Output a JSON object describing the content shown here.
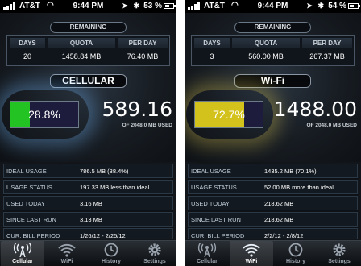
{
  "screens": [
    {
      "id": "cellular",
      "status": {
        "carrier": "AT&T",
        "time": "9:44 PM",
        "battery": "53 %"
      },
      "remaining": {
        "title": "REMAINING",
        "days_label": "DAYS",
        "days": "20",
        "quota_label": "QUOTA",
        "quota": "1458.84 MB",
        "perday_label": "PER DAY",
        "perday": "76.40 MB"
      },
      "mode": "CELLULAR",
      "gauge": {
        "percent_text": "28.8%",
        "fraction": 0.288,
        "color": "#22c322"
      },
      "used": {
        "value": "589.16",
        "caption": "OF 2048.0 MB USED"
      },
      "stats": [
        {
          "label": "IDEAL USAGE",
          "value": "786.5 MB (38.4%)"
        },
        {
          "label": "USAGE STATUS",
          "value": "197.33 MB less than ideal"
        },
        {
          "label": "USED TODAY",
          "value": "3.16 MB"
        },
        {
          "label": "SINCE LAST RUN",
          "value": "3.13 MB"
        },
        {
          "label": "CUR. BILL PERIOD",
          "value": "1/26/12 - 2/25/12"
        }
      ],
      "tabs": [
        "Cellular",
        "WiFi",
        "History",
        "Settings"
      ],
      "active_tab": 0
    },
    {
      "id": "wifi",
      "status": {
        "carrier": "AT&T",
        "time": "9:44 PM",
        "battery": "54 %"
      },
      "remaining": {
        "title": "REMAINING",
        "days_label": "DAYS",
        "days": "3",
        "quota_label": "QUOTA",
        "quota": "560.00 MB",
        "perday_label": "PER DAY",
        "perday": "267.37 MB"
      },
      "mode": "Wi-Fi",
      "gauge": {
        "percent_text": "72.7%",
        "fraction": 0.727,
        "color": "#d4c21c"
      },
      "used": {
        "value": "1488.00",
        "caption": "OF 2048.0 MB USED"
      },
      "stats": [
        {
          "label": "IDEAL USAGE",
          "value": "1435.2 MB (70.1%)"
        },
        {
          "label": "USAGE STATUS",
          "value": "52.00 MB more than ideal"
        },
        {
          "label": "USED TODAY",
          "value": "218.62 MB"
        },
        {
          "label": "SINCE LAST RUN",
          "value": "218.62 MB"
        },
        {
          "label": "CUR. BILL PERIOD",
          "value": "2/2/12 - 2/8/12"
        }
      ],
      "tabs": [
        "Cellular",
        "WiFi",
        "History",
        "Settings"
      ],
      "active_tab": 1
    }
  ],
  "icons": [
    "cellular-icon",
    "wifi-icon",
    "history-clock-icon",
    "settings-gear-icon"
  ]
}
